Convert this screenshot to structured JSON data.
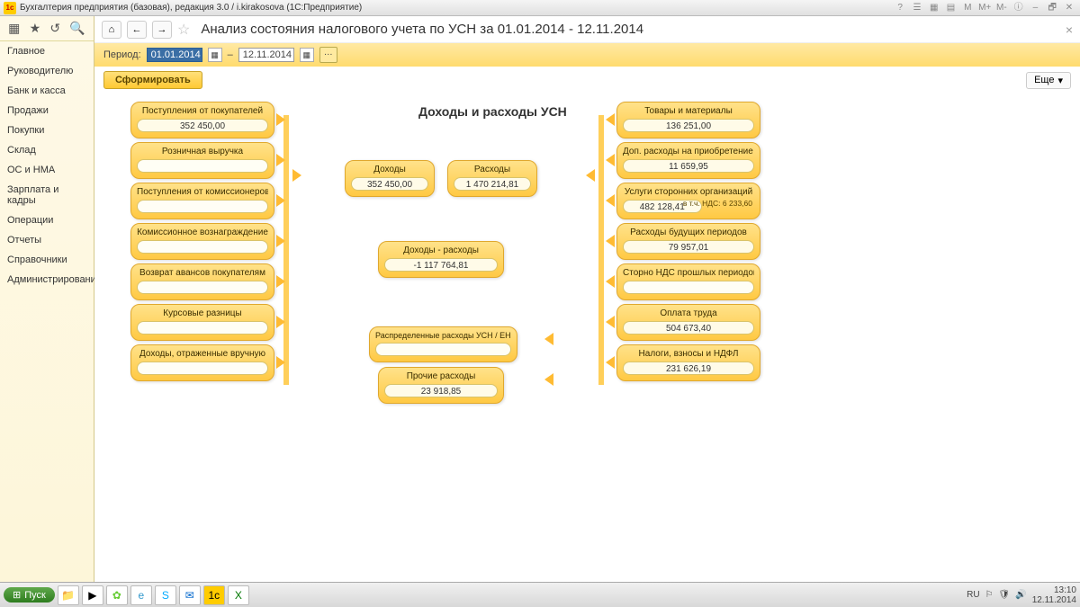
{
  "titlebar": {
    "app_logo": "1c",
    "title": "Бухгалтерия предприятия (базовая), редакция 3.0 / i.kirakosova  (1С:Предприятие)"
  },
  "sidebar": {
    "items": [
      {
        "label": "Главное"
      },
      {
        "label": "Руководителю"
      },
      {
        "label": "Банк и касса"
      },
      {
        "label": "Продажи"
      },
      {
        "label": "Покупки"
      },
      {
        "label": "Склад"
      },
      {
        "label": "ОС и НМА"
      },
      {
        "label": "Зарплата и кадры"
      },
      {
        "label": "Операции"
      },
      {
        "label": "Отчеты"
      },
      {
        "label": "Справочники"
      },
      {
        "label": "Администрирование"
      }
    ]
  },
  "header": {
    "title": "Анализ состояния налогового учета по УСН за 01.01.2014 - 12.11.2014"
  },
  "period": {
    "label": "Период:",
    "from": "01.01.2014",
    "to": "12.11.2014",
    "dash": "–"
  },
  "actions": {
    "generate": "Сформировать",
    "more": "Еще"
  },
  "diagram": {
    "title": "Доходы и расходы УСН",
    "left": [
      {
        "label": "Поступления от покупателей",
        "value": "352 450,00"
      },
      {
        "label": "Розничная выручка",
        "value": ""
      },
      {
        "label": "Поступления от комиссионеров",
        "value": ""
      },
      {
        "label": "Комиссионное вознаграждение",
        "value": ""
      },
      {
        "label": "Возврат авансов покупателям",
        "value": ""
      },
      {
        "label": "Курсовые разницы",
        "value": ""
      },
      {
        "label": "Доходы, отраженные вручную",
        "value": ""
      }
    ],
    "center": {
      "income": {
        "label": "Доходы",
        "value": "352 450,00"
      },
      "expense": {
        "label": "Расходы",
        "value": "1 470 214,81"
      },
      "diff": {
        "label": "Доходы - расходы",
        "value": "-1 117 764,81"
      },
      "dist": {
        "label": "Распределенные расходы УСН / ЕНВД",
        "value": ""
      },
      "other": {
        "label": "Прочие расходы",
        "value": "23 918,85"
      }
    },
    "right": [
      {
        "label": "Товары и материалы",
        "value": "136 251,00"
      },
      {
        "label": "Доп. расходы на приобретение ТМЦ",
        "value": "11 659,95"
      },
      {
        "label": "Услуги сторонних организаций",
        "value": "482 128,41",
        "extra": "в т.ч. НДС: 6 233,60"
      },
      {
        "label": "Расходы будущих периодов",
        "value": "79 957,01"
      },
      {
        "label": "Сторно НДС прошлых периодов",
        "value": ""
      },
      {
        "label": "Оплата труда",
        "value": "504 673,40"
      },
      {
        "label": "Налоги, взносы и НДФЛ",
        "value": "231 626,19"
      }
    ]
  },
  "taskbar": {
    "start": "Пуск",
    "lang": "RU",
    "time": "13:10",
    "date": "12.11.2014"
  }
}
